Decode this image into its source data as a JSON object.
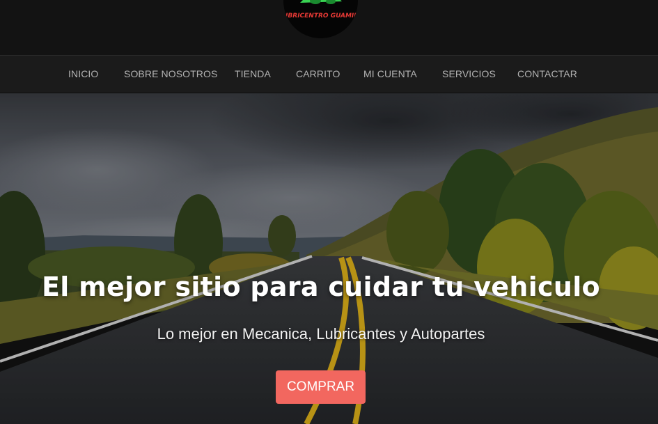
{
  "brand": {
    "logo_text": "LUBRICENTRO GUAMINI",
    "colors": {
      "logo_text": "#e53935",
      "logo_car": "#39d353"
    }
  },
  "nav": {
    "items": [
      {
        "label": "INICIO"
      },
      {
        "label": "SOBRE NOSOTROS"
      },
      {
        "label": "TIENDA"
      },
      {
        "label": "CARRITO"
      },
      {
        "label": "MI CUENTA"
      },
      {
        "label": "SERVICIOS"
      },
      {
        "label": "CONTACTAR"
      }
    ]
  },
  "hero": {
    "title": "El mejor sitio para cuidar tu vehiculo",
    "subtitle": "Lo mejor en Mecanica, Lubricantes y Autopartes",
    "cta_label": "COMPRAR",
    "colors": {
      "cta": "#f2675f"
    }
  }
}
